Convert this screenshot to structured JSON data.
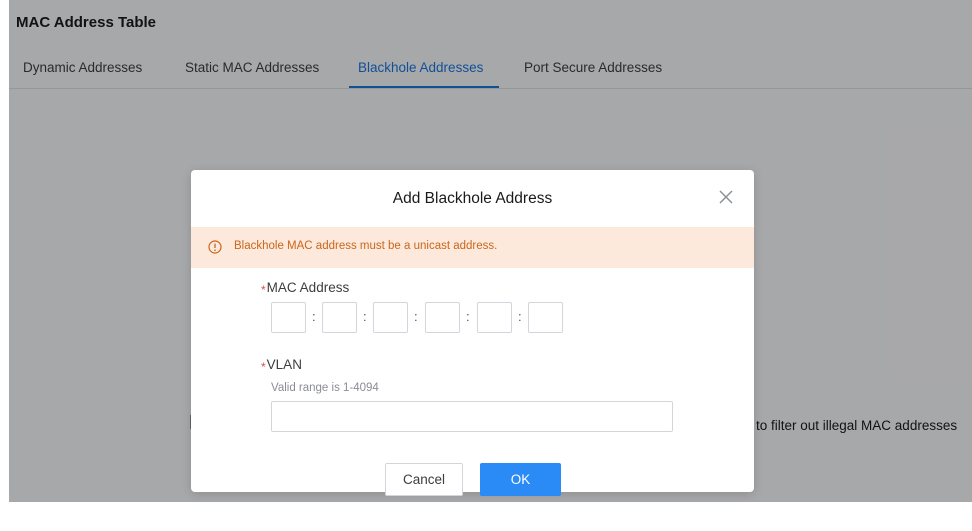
{
  "page": {
    "title": "MAC Address Table",
    "tabs": [
      {
        "label": "Dynamic Addresses",
        "active": false
      },
      {
        "label": "Static MAC Addresses",
        "active": false
      },
      {
        "label": "Blackhole Addresses",
        "active": true
      },
      {
        "label": "Port Secure Addresses",
        "active": false
      }
    ],
    "background_text": "to filter out illegal MAC addresses"
  },
  "modal": {
    "title": "Add Blackhole Address",
    "close_icon": "close-icon",
    "alert": {
      "icon": "info-circle-icon",
      "text": "Blackhole MAC address must be a unicast address.",
      "color": "#c9661c",
      "background": "#fde9dc"
    },
    "mac_field": {
      "required_mark": "*",
      "label": "MAC Address",
      "separator": ":",
      "segments": [
        "",
        "",
        "",
        "",
        "",
        ""
      ]
    },
    "vlan_field": {
      "required_mark": "*",
      "label": "VLAN",
      "hint": "Valid range is 1-4094",
      "value": ""
    },
    "buttons": {
      "cancel": "Cancel",
      "ok": "OK"
    }
  },
  "colors": {
    "accent": "#1b72d8",
    "primary_button": "#2a8af6",
    "required": "#e5484d"
  }
}
